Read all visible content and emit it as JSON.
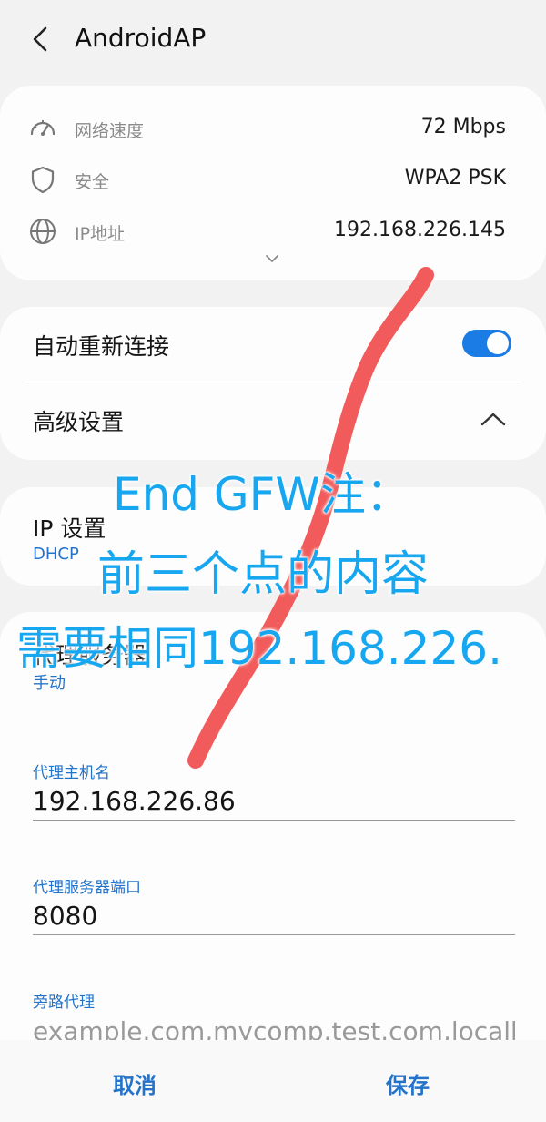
{
  "header": {
    "title": "AndroidAP"
  },
  "info": {
    "rows": [
      {
        "label": "网络速度",
        "value": "72 Mbps",
        "icon": "speed-gauge-icon"
      },
      {
        "label": "安全",
        "value": "WPA2 PSK",
        "icon": "shield-icon"
      },
      {
        "label": "IP地址",
        "value": "192.168.226.145",
        "icon": "globe-icon"
      }
    ]
  },
  "settings": {
    "auto_reconnect_label": "自动重新连接",
    "auto_reconnect_on": true,
    "advanced_label": "高级设置"
  },
  "ip_settings": {
    "label": "IP 设置",
    "value": "DHCP"
  },
  "proxy": {
    "label": "代理服务器",
    "value": "手动",
    "hostname_label": "代理主机名",
    "hostname_value": "192.168.226.86",
    "port_label": "代理服务器端口",
    "port_value": "8080",
    "bypass_label": "旁路代理",
    "bypass_placeholder": "example.com,mycomp.test.com,localhost"
  },
  "bottom": {
    "cancel_label": "取消",
    "save_label": "保存"
  },
  "annotation": {
    "line1": "End GFW注：",
    "line2": "前三个点的内容",
    "line3": "需要相同192.168.226.",
    "text_color": "#17a6f0",
    "stroke_color": "#f15252"
  },
  "colors": {
    "accent": "#2473c9",
    "toggle": "#1c7ce6",
    "background": "#f2f2f2",
    "card": "#fdfdfd"
  }
}
